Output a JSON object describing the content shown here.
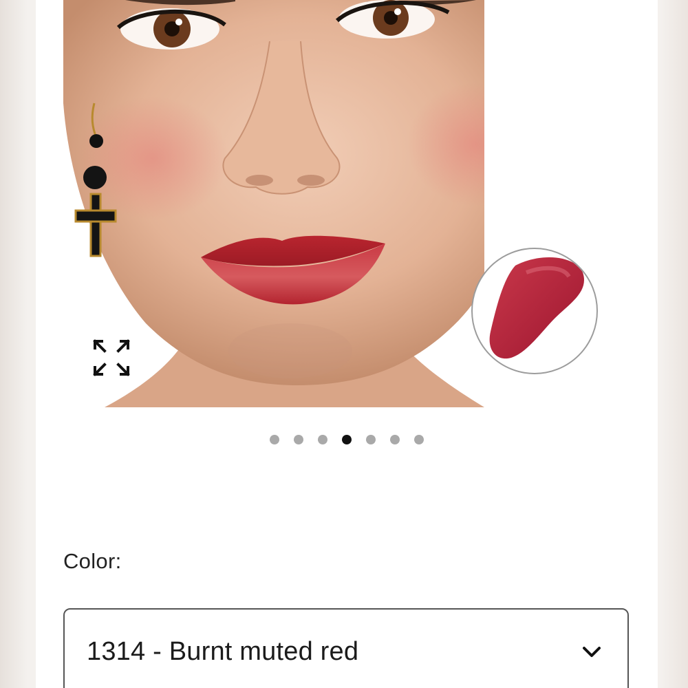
{
  "product": {
    "image_alt": "Model wearing red lipstick",
    "swatch_color": "#b0213a",
    "lip_color": "#c7333f"
  },
  "carousel": {
    "total_slides": 7,
    "active_index": 3
  },
  "color_selector": {
    "label": "Color:",
    "selected_value": "1314 - Burnt muted red"
  },
  "icons": {
    "expand": "expand-arrows-icon",
    "chevron": "chevron-down-icon"
  }
}
